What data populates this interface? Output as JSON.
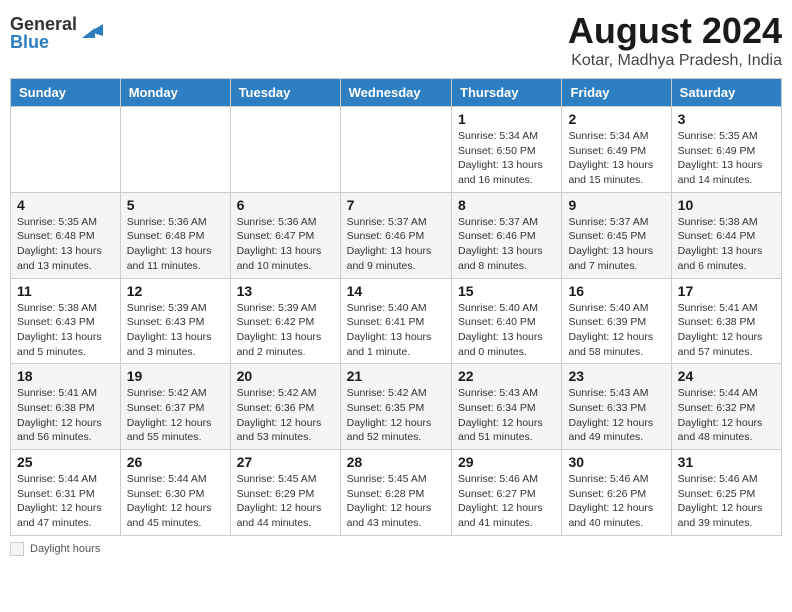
{
  "header": {
    "logo_line1": "General",
    "logo_line2": "Blue",
    "month": "August 2024",
    "location": "Kotar, Madhya Pradesh, India"
  },
  "weekdays": [
    "Sunday",
    "Monday",
    "Tuesday",
    "Wednesday",
    "Thursday",
    "Friday",
    "Saturday"
  ],
  "weeks": [
    [
      {
        "day": "",
        "info": ""
      },
      {
        "day": "",
        "info": ""
      },
      {
        "day": "",
        "info": ""
      },
      {
        "day": "",
        "info": ""
      },
      {
        "day": "1",
        "info": "Sunrise: 5:34 AM\nSunset: 6:50 PM\nDaylight: 13 hours and 16 minutes."
      },
      {
        "day": "2",
        "info": "Sunrise: 5:34 AM\nSunset: 6:49 PM\nDaylight: 13 hours and 15 minutes."
      },
      {
        "day": "3",
        "info": "Sunrise: 5:35 AM\nSunset: 6:49 PM\nDaylight: 13 hours and 14 minutes."
      }
    ],
    [
      {
        "day": "4",
        "info": "Sunrise: 5:35 AM\nSunset: 6:48 PM\nDaylight: 13 hours and 13 minutes."
      },
      {
        "day": "5",
        "info": "Sunrise: 5:36 AM\nSunset: 6:48 PM\nDaylight: 13 hours and 11 minutes."
      },
      {
        "day": "6",
        "info": "Sunrise: 5:36 AM\nSunset: 6:47 PM\nDaylight: 13 hours and 10 minutes."
      },
      {
        "day": "7",
        "info": "Sunrise: 5:37 AM\nSunset: 6:46 PM\nDaylight: 13 hours and 9 minutes."
      },
      {
        "day": "8",
        "info": "Sunrise: 5:37 AM\nSunset: 6:46 PM\nDaylight: 13 hours and 8 minutes."
      },
      {
        "day": "9",
        "info": "Sunrise: 5:37 AM\nSunset: 6:45 PM\nDaylight: 13 hours and 7 minutes."
      },
      {
        "day": "10",
        "info": "Sunrise: 5:38 AM\nSunset: 6:44 PM\nDaylight: 13 hours and 6 minutes."
      }
    ],
    [
      {
        "day": "11",
        "info": "Sunrise: 5:38 AM\nSunset: 6:43 PM\nDaylight: 13 hours and 5 minutes."
      },
      {
        "day": "12",
        "info": "Sunrise: 5:39 AM\nSunset: 6:43 PM\nDaylight: 13 hours and 3 minutes."
      },
      {
        "day": "13",
        "info": "Sunrise: 5:39 AM\nSunset: 6:42 PM\nDaylight: 13 hours and 2 minutes."
      },
      {
        "day": "14",
        "info": "Sunrise: 5:40 AM\nSunset: 6:41 PM\nDaylight: 13 hours and 1 minute."
      },
      {
        "day": "15",
        "info": "Sunrise: 5:40 AM\nSunset: 6:40 PM\nDaylight: 13 hours and 0 minutes."
      },
      {
        "day": "16",
        "info": "Sunrise: 5:40 AM\nSunset: 6:39 PM\nDaylight: 12 hours and 58 minutes."
      },
      {
        "day": "17",
        "info": "Sunrise: 5:41 AM\nSunset: 6:38 PM\nDaylight: 12 hours and 57 minutes."
      }
    ],
    [
      {
        "day": "18",
        "info": "Sunrise: 5:41 AM\nSunset: 6:38 PM\nDaylight: 12 hours and 56 minutes."
      },
      {
        "day": "19",
        "info": "Sunrise: 5:42 AM\nSunset: 6:37 PM\nDaylight: 12 hours and 55 minutes."
      },
      {
        "day": "20",
        "info": "Sunrise: 5:42 AM\nSunset: 6:36 PM\nDaylight: 12 hours and 53 minutes."
      },
      {
        "day": "21",
        "info": "Sunrise: 5:42 AM\nSunset: 6:35 PM\nDaylight: 12 hours and 52 minutes."
      },
      {
        "day": "22",
        "info": "Sunrise: 5:43 AM\nSunset: 6:34 PM\nDaylight: 12 hours and 51 minutes."
      },
      {
        "day": "23",
        "info": "Sunrise: 5:43 AM\nSunset: 6:33 PM\nDaylight: 12 hours and 49 minutes."
      },
      {
        "day": "24",
        "info": "Sunrise: 5:44 AM\nSunset: 6:32 PM\nDaylight: 12 hours and 48 minutes."
      }
    ],
    [
      {
        "day": "25",
        "info": "Sunrise: 5:44 AM\nSunset: 6:31 PM\nDaylight: 12 hours and 47 minutes."
      },
      {
        "day": "26",
        "info": "Sunrise: 5:44 AM\nSunset: 6:30 PM\nDaylight: 12 hours and 45 minutes."
      },
      {
        "day": "27",
        "info": "Sunrise: 5:45 AM\nSunset: 6:29 PM\nDaylight: 12 hours and 44 minutes."
      },
      {
        "day": "28",
        "info": "Sunrise: 5:45 AM\nSunset: 6:28 PM\nDaylight: 12 hours and 43 minutes."
      },
      {
        "day": "29",
        "info": "Sunrise: 5:46 AM\nSunset: 6:27 PM\nDaylight: 12 hours and 41 minutes."
      },
      {
        "day": "30",
        "info": "Sunrise: 5:46 AM\nSunset: 6:26 PM\nDaylight: 12 hours and 40 minutes."
      },
      {
        "day": "31",
        "info": "Sunrise: 5:46 AM\nSunset: 6:25 PM\nDaylight: 12 hours and 39 minutes."
      }
    ]
  ],
  "footer": {
    "daylight_label": "Daylight hours"
  }
}
